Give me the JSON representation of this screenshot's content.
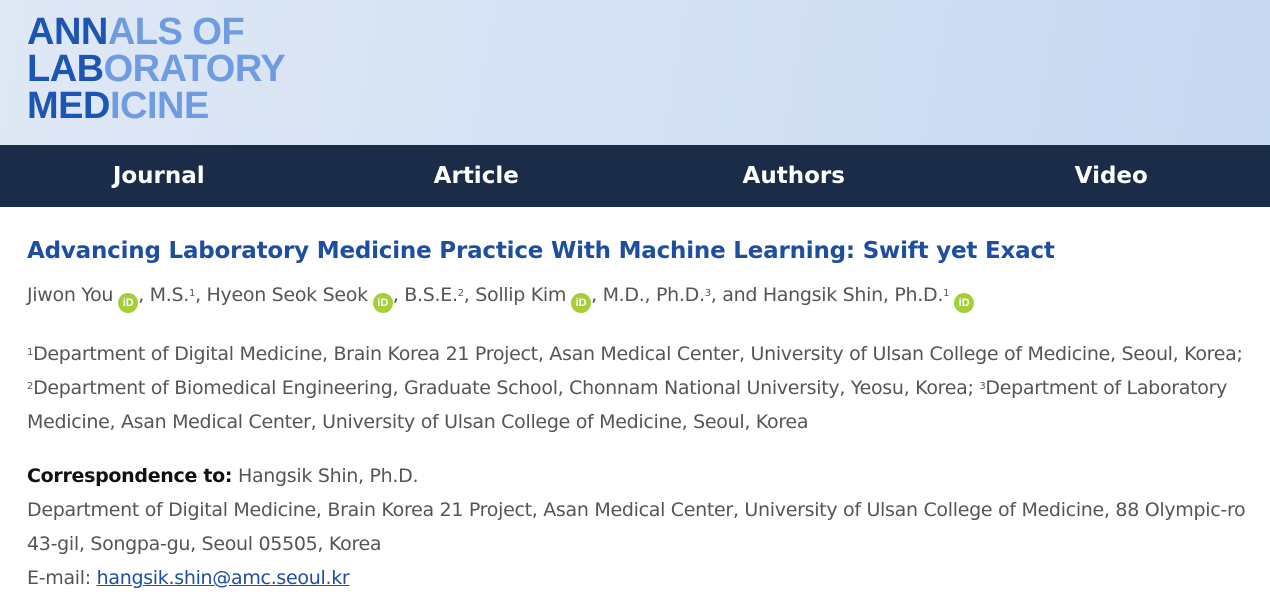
{
  "logo": {
    "line1_dark": "ANN",
    "line1_light": "ALS OF",
    "line2_dark": "LAB",
    "line2_light": "ORATORY",
    "line3_dark": "MED",
    "line3_light": "ICINE"
  },
  "nav": {
    "items": [
      {
        "label": "Journal"
      },
      {
        "label": "Article"
      },
      {
        "label": "Authors"
      },
      {
        "label": "Video"
      }
    ]
  },
  "article": {
    "title": "Advancing Laboratory Medicine Practice With Machine Learning: Swift yet Exact",
    "orcid_icon_text": "iD",
    "authors": [
      {
        "name": "Jiwon You",
        "degree": ", M.S.",
        "aff": "1"
      },
      {
        "name": "Hyeon Seok Seok",
        "degree": ", B.S.E.",
        "aff": "2"
      },
      {
        "name": "Sollip Kim",
        "degree": ", M.D., Ph.D.",
        "aff": "3"
      },
      {
        "name": "and Hangsik Shin, Ph.D.",
        "aff": "1"
      }
    ],
    "separator": ", ",
    "affiliations": [
      {
        "num": "1",
        "text": "Department of Digital Medicine, Brain Korea 21 Project, Asan Medical Center, University of Ulsan College of Medicine, Seoul, Korea; "
      },
      {
        "num": "2",
        "text": "Department of Biomedical Engineering, Graduate School, Chonnam National University, Yeosu, Korea; "
      },
      {
        "num": "3",
        "text": "Department of Laboratory Medicine, Asan Medical Center, University of Ulsan College of Medicine, Seoul, Korea"
      }
    ],
    "correspondence": {
      "label": "Correspondence to:",
      "name": " Hangsik Shin, Ph.D.",
      "address": "Department of Digital Medicine, Brain Korea 21 Project, Asan Medical Center, University of Ulsan College of Medicine, 88 Olympic-ro 43-gil, Songpa-gu, Seoul 05505, Korea",
      "email_label": "E-mail: ",
      "email": "hangsik.shin@amc.seoul.kr"
    }
  },
  "colors": {
    "brand_dark": "#1d55b3",
    "brand_light": "#6f9be0",
    "nav_bg": "#1a2c47",
    "title": "#1d4ea1",
    "orcid": "#a6ce39"
  }
}
